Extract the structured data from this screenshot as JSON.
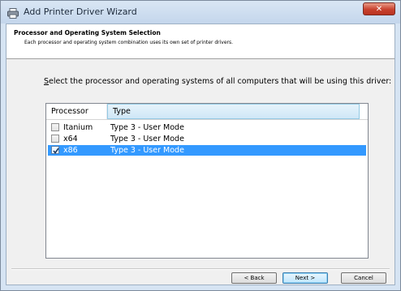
{
  "window": {
    "title": "Add Printer Driver Wizard",
    "close_label": "✕"
  },
  "header": {
    "title": "Processor and Operating System Selection",
    "subtitle": "Each processor and operating system combination uses its own set of printer drivers."
  },
  "instruction": {
    "mnemonic": "S",
    "rest": "elect the processor and operating systems of all computers that will be using this driver:"
  },
  "list": {
    "columns": [
      "Processor",
      "Type"
    ],
    "rows": [
      {
        "processor": "Itanium",
        "type": "Type 3 - User Mode",
        "checked": false,
        "selected": false
      },
      {
        "processor": "x64",
        "type": "Type 3 - User Mode",
        "checked": false,
        "selected": false
      },
      {
        "processor": "x86",
        "type": "Type 3 - User Mode",
        "checked": true,
        "selected": true
      }
    ]
  },
  "buttons": {
    "back": "< Back",
    "next": "Next >",
    "cancel": "Cancel"
  },
  "colors": {
    "selection": "#3399ff",
    "close_button": "#c8412e"
  },
  "icons": {
    "title": "printer-icon",
    "check": "checkmark-icon"
  }
}
